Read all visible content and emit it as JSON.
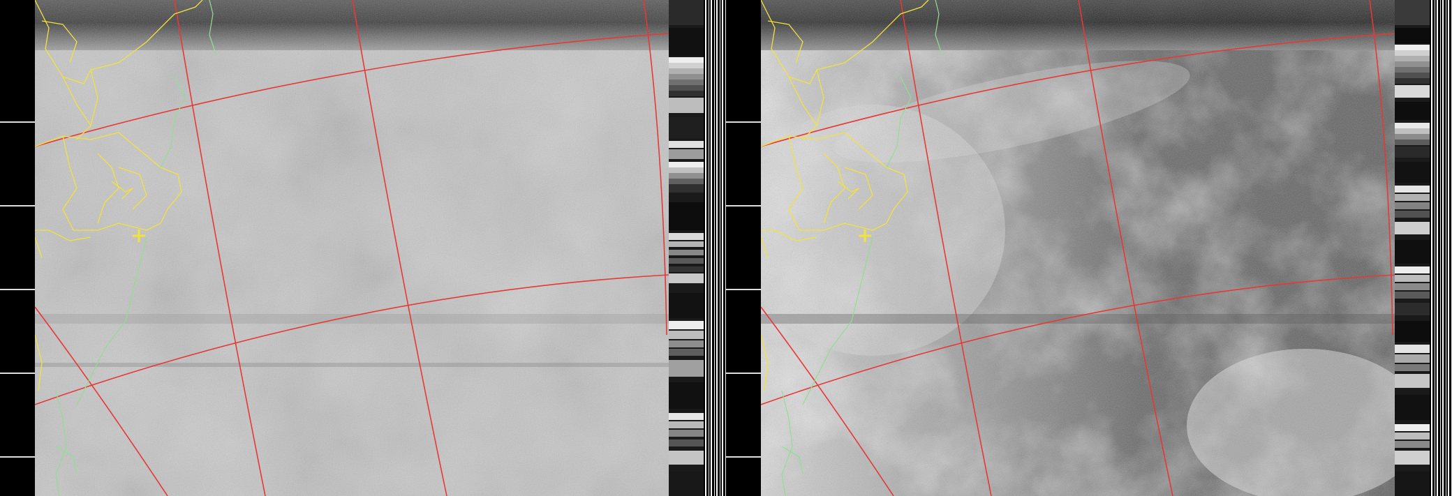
{
  "image": {
    "description_free": true,
    "channels": [
      {
        "id": "a",
        "tone": "visible-light",
        "base": "#c9c9c9"
      },
      {
        "id": "b",
        "tone": "infrared",
        "base": "#6e6e6e"
      }
    ]
  },
  "colors": {
    "grid_line": "#e53935",
    "country_border": "#f2e23c",
    "coastline": "#8fe08f",
    "city_marker": "#f2e23c",
    "sync_marker": "#dddddd"
  },
  "icons": {
    "city_marker": "cross-marker-icon"
  }
}
